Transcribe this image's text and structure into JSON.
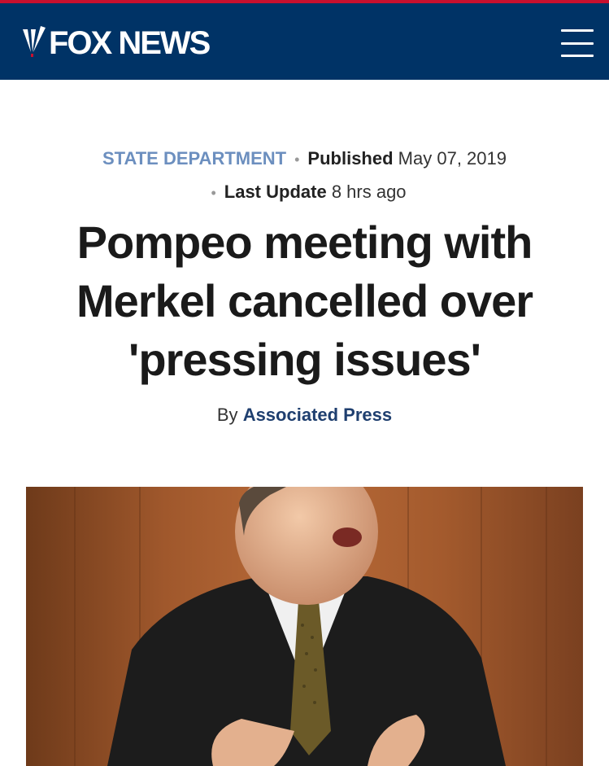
{
  "header": {
    "brand": "FOX NEWS",
    "brand_color": "#003366",
    "accent_color": "#c8102e",
    "menu_icon": "hamburger-menu-icon"
  },
  "article": {
    "category": "STATE DEPARTMENT",
    "published_label": "Published",
    "published_date": "May 07, 2019",
    "updated_label": "Last Update",
    "updated_value": "8 hrs ago",
    "headline": "Pompeo meeting with Merkel cancelled over 'pressing issues'",
    "byline_prefix": "By",
    "author": "Associated Press"
  },
  "photo": {
    "subject": "man in dark suit speaking at podium"
  }
}
